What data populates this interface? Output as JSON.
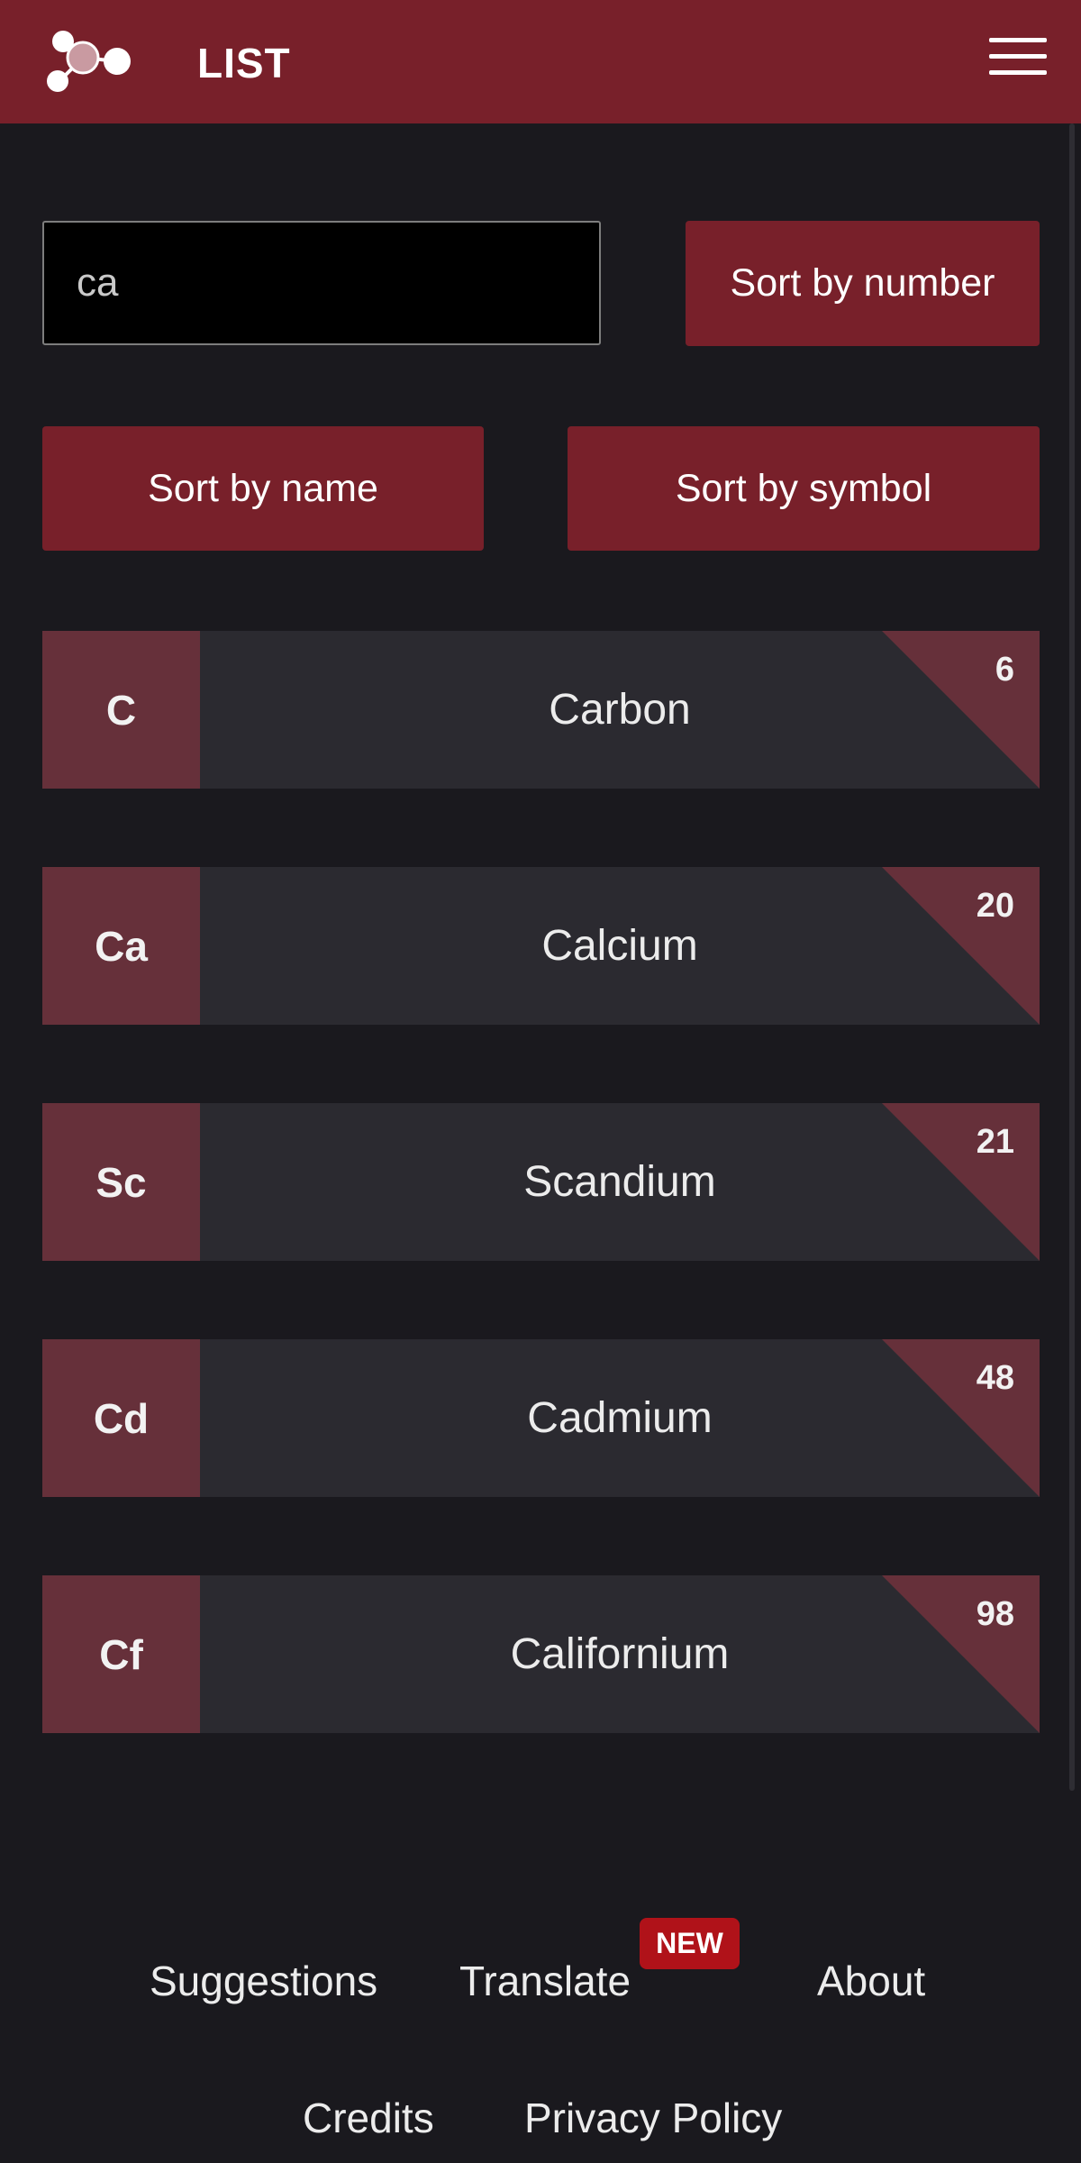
{
  "header": {
    "title": "LIST",
    "logo_icon": "molecule-logo-icon",
    "menu_icon": "hamburger-menu-icon"
  },
  "search": {
    "value": "ca"
  },
  "sort_buttons": {
    "by_number": "Sort by number",
    "by_name": "Sort by name",
    "by_symbol": "Sort by symbol"
  },
  "elements": [
    {
      "symbol": "C",
      "name": "Carbon",
      "number": "6"
    },
    {
      "symbol": "Ca",
      "name": "Calcium",
      "number": "20"
    },
    {
      "symbol": "Sc",
      "name": "Scandium",
      "number": "21"
    },
    {
      "symbol": "Cd",
      "name": "Cadmium",
      "number": "48"
    },
    {
      "symbol": "Cf",
      "name": "Californium",
      "number": "98"
    }
  ],
  "footer": {
    "suggestions": "Suggestions",
    "translate": "Translate",
    "new_badge": "NEW",
    "about": "About",
    "credits": "Credits",
    "privacy": "Privacy Policy"
  },
  "colors": {
    "brand": "#78202a",
    "background": "#1a191e",
    "row": "#2b2a30",
    "symbol_cell": "#66303a",
    "badge": "#b01219"
  }
}
